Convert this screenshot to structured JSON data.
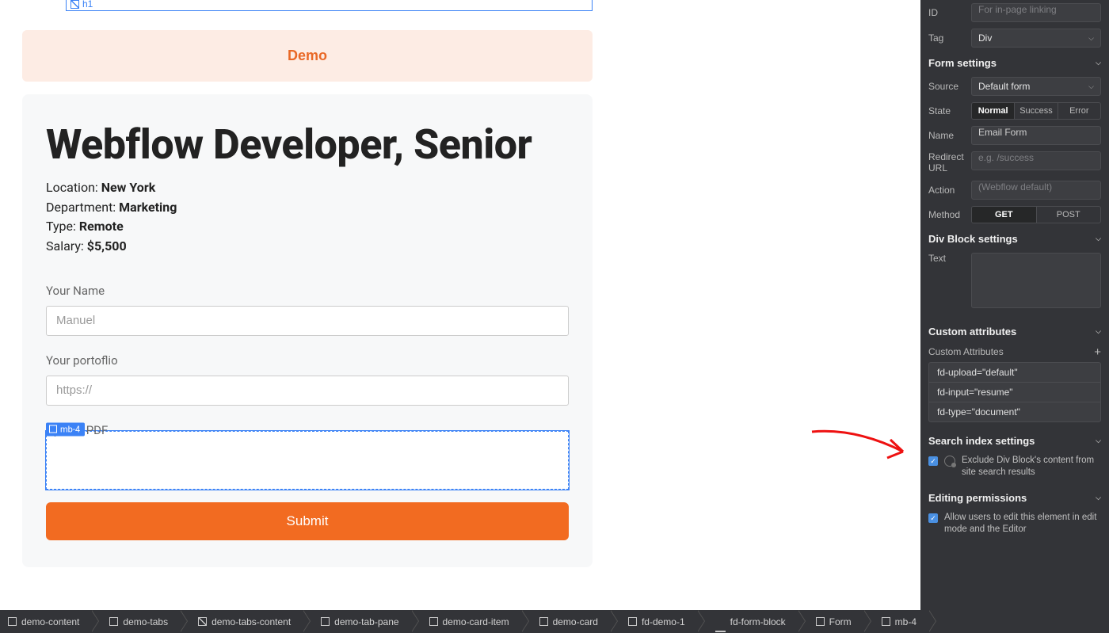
{
  "canvas": {
    "h1_tag": "h1",
    "demo_label": "Demo",
    "title": "Webflow Developer, Senior",
    "meta": {
      "location_label": "Location:",
      "location_val": "New York",
      "department_label": "Department:",
      "department_val": "Marketing",
      "type_label": "Type:",
      "type_val": "Remote",
      "salary_label": "Salary:",
      "salary_val": "$5,500"
    },
    "form": {
      "name_label": "Your Name",
      "name_placeholder": "Manuel",
      "portfolio_label": "Your portoflio",
      "portfolio_placeholder": "https://",
      "upload_label": "Upload PDF",
      "selected_tag": "mb-4",
      "submit": "Submit"
    }
  },
  "inspector": {
    "id_label": "ID",
    "id_placeholder": "For in-page linking",
    "tag_label": "Tag",
    "tag_value": "Div",
    "form_settings_head": "Form settings",
    "source_label": "Source",
    "source_value": "Default form",
    "state_label": "State",
    "state_options": [
      "Normal",
      "Success",
      "Error"
    ],
    "state_active": "Normal",
    "name_label": "Name",
    "name_value": "Email Form",
    "redirect_label": "Redirect URL",
    "redirect_placeholder": "e.g. /success",
    "action_label": "Action",
    "action_placeholder": "(Webflow default)",
    "method_label": "Method",
    "method_options": [
      "GET",
      "POST"
    ],
    "method_active": "GET",
    "div_settings_head": "Div Block settings",
    "text_label": "Text",
    "custom_attrs_head": "Custom attributes",
    "custom_attrs_subhead": "Custom Attributes",
    "attrs": [
      "fd-upload=\"default\"",
      "fd-input=\"resume\"",
      "fd-type=\"document\""
    ],
    "search_head": "Search index settings",
    "search_checkbox": "Exclude Div Block's content from site search results",
    "editing_head": "Editing permissions",
    "editing_checkbox": "Allow users to edit this element in edit mode and the Editor"
  },
  "breadcrumb": [
    {
      "icon": "sq",
      "label": "demo-content"
    },
    {
      "icon": "sq",
      "label": "demo-tabs"
    },
    {
      "icon": "diag",
      "label": "demo-tabs-content"
    },
    {
      "icon": "sq",
      "label": "demo-tab-pane"
    },
    {
      "icon": "sq",
      "label": "demo-card-item"
    },
    {
      "icon": "sq",
      "label": "demo-card"
    },
    {
      "icon": "sq",
      "label": "fd-demo-1"
    },
    {
      "icon": "form",
      "label": "fd-form-block"
    },
    {
      "icon": "sq",
      "label": "Form"
    },
    {
      "icon": "sq",
      "label": "mb-4"
    }
  ]
}
